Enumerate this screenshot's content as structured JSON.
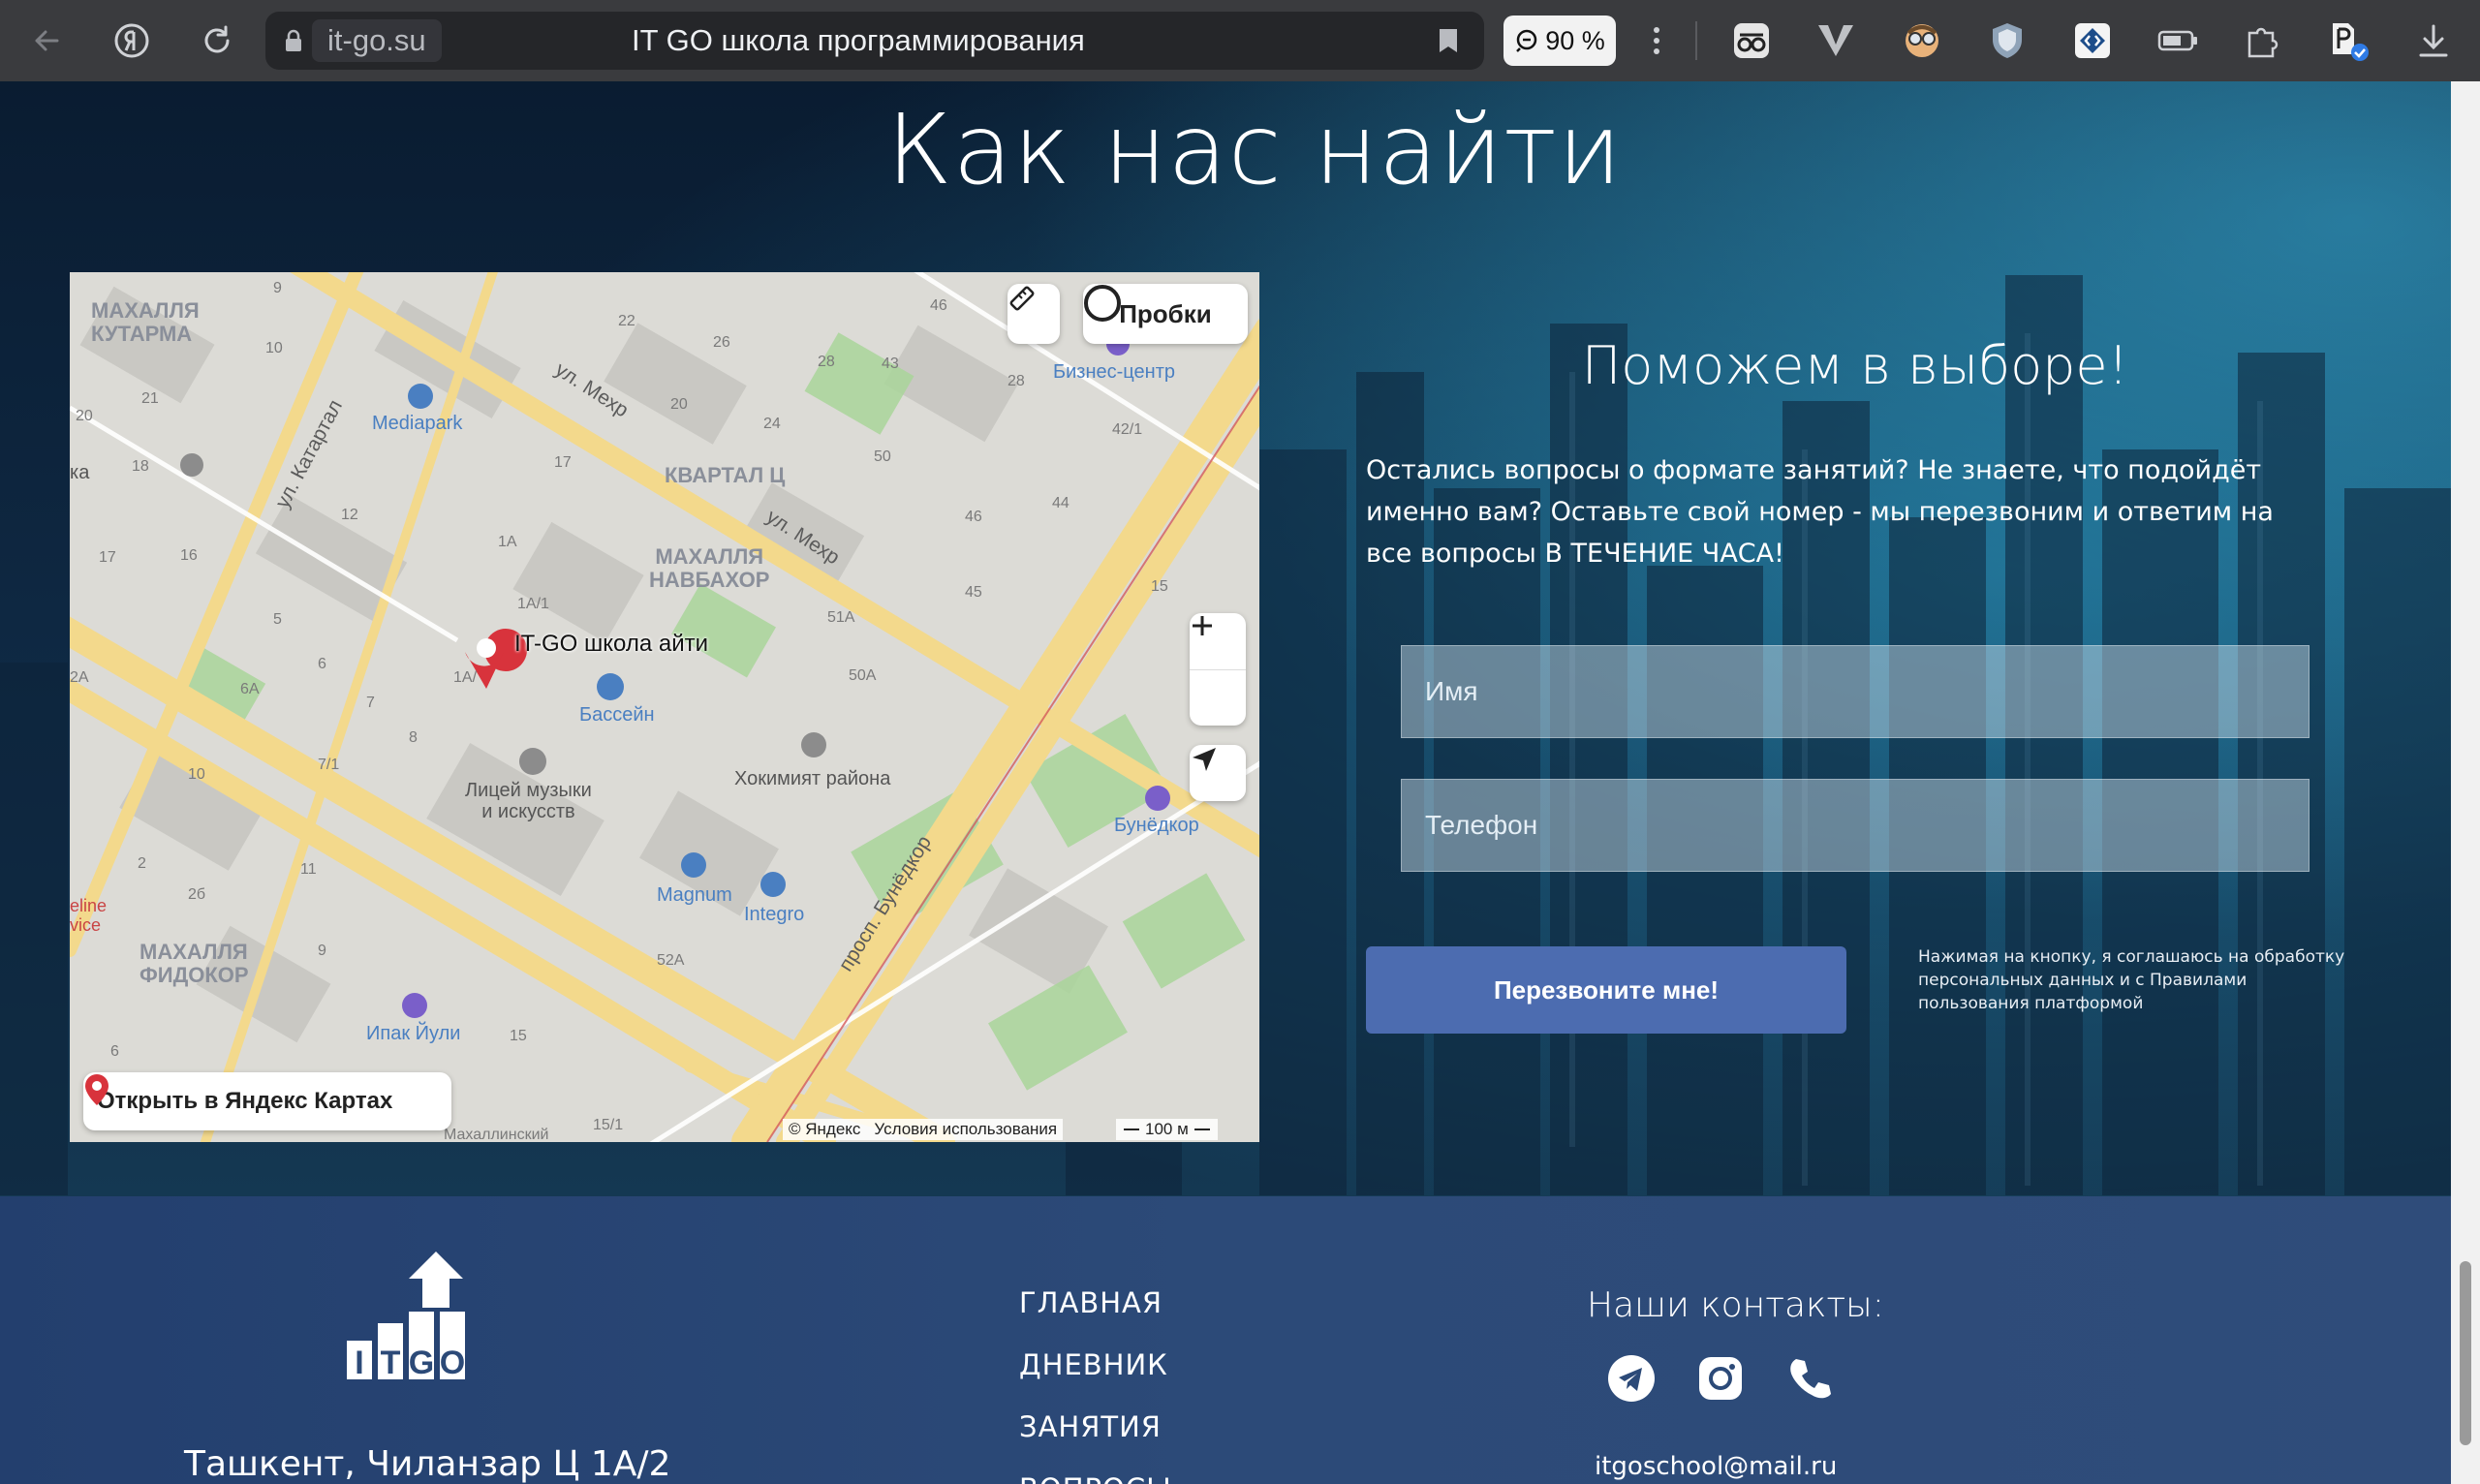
{
  "browser": {
    "domain": "it-go.su",
    "page_title": "IT GO школа программирования",
    "zoom": "90 %"
  },
  "section": {
    "heading": "Как нас найти"
  },
  "map": {
    "place_label": "IT-GO школа айти",
    "traffic_label": "Пробки",
    "open_label": "Открыть в Яндекс Картах",
    "copyright": "© Яндекс",
    "terms": "Условия использования",
    "scale": "100 м",
    "districts": [
      "МАХАЛЛЯ\nКУТАРМА",
      "КВАРТАЛ Ц",
      "МАХАЛЛЯ\nНАВБАХОР",
      "МАХАЛЛЯ\nФИДОКОР"
    ],
    "pois": [
      "Mediapark",
      "Бизнес-центр",
      "Бассейн",
      "Хокимият района",
      "Лицей музыки\nи искусств",
      "Magnum",
      "Integro",
      "Бунёдкор",
      "Ипак Йули"
    ],
    "streets": [
      "ул. Мехр",
      "ул. Мехр",
      "ул. Катартал",
      "просп. Бунёдкор"
    ],
    "numbers": [
      "9",
      "10",
      "21",
      "20",
      "18",
      "17",
      "16",
      "12",
      "1А",
      "5",
      "6",
      "6А",
      "7",
      "8",
      "7/1",
      "10",
      "2",
      "2б",
      "11",
      "9",
      "6",
      "15",
      "22",
      "26",
      "28",
      "43",
      "46",
      "24",
      "20",
      "17",
      "50",
      "46",
      "44",
      "45",
      "51А",
      "50А",
      "15",
      "42/1",
      "52А",
      "15/1",
      "28",
      "1А/1",
      "1А/"
    ],
    "edge_labels": [
      "ка",
      "2А",
      "eline",
      "vice",
      "Махаллинский"
    ]
  },
  "form": {
    "title": "Поможем в выборе!",
    "text": "Остались вопросы о формате занятий? Не знаете, что подойдёт именно вам? Оставьте свой номер - мы перезвоним и ответим на все вопросы В ТЕЧЕНИЕ ЧАСА!",
    "name_placeholder": "Имя",
    "phone_placeholder": "Телефон",
    "submit_label": "Перезвоните мне!",
    "consent": "Нажимая на кнопку, я соглашаюсь на обработку персональных данных и с Правилами пользования платформой"
  },
  "footer": {
    "logo_text": "ITGO",
    "address": "Ташкент, Чиланзар Ц 1А/2",
    "menu": [
      "ГЛАВНАЯ",
      "ДНЕВНИК",
      "ЗАНЯТИЯ",
      "ВОПРОСЫ"
    ],
    "contacts_title": "Наши контакты:",
    "email": "itgoschool@mail.ru",
    "social_icons": [
      "telegram-icon",
      "instagram-icon",
      "phone-icon"
    ]
  },
  "colors": {
    "button": "#4c6cb0",
    "footer": "#2c4a78",
    "map_pin": "#d8333c"
  }
}
